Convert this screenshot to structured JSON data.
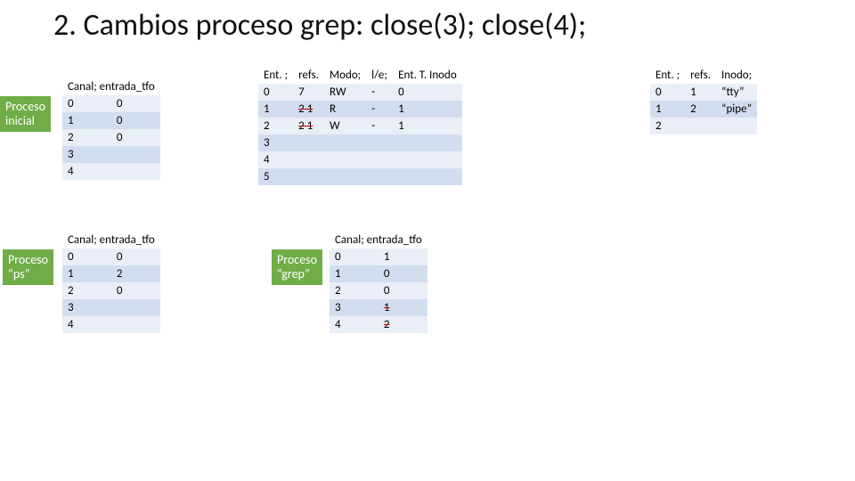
{
  "title": "2. Cambios proceso grep: close(3); close(4);",
  "labels": {
    "inicial": "Proceso\ninicial",
    "ps": "Proceso\n“ps”",
    "grep": "Proceso\n“grep”"
  },
  "headers": {
    "canal_2col": [
      "Canal;",
      "entrada_tfo"
    ],
    "tfo": [
      "Ent. ;",
      "refs.",
      "Modo;",
      "l/e;",
      "Ent. T. Inodo"
    ],
    "inode": [
      "Ent. ;",
      "refs.",
      "Inodo;"
    ]
  },
  "inicial": {
    "rows": [
      {
        "c0": "0",
        "c1": "0"
      },
      {
        "c0": "1",
        "c1": "0"
      },
      {
        "c0": "2",
        "c1": "0"
      },
      {
        "c0": "3",
        "c1": ""
      },
      {
        "c0": "4",
        "c1": ""
      }
    ]
  },
  "ps": {
    "rows": [
      {
        "c0": "0",
        "c1": "0"
      },
      {
        "c0": "1",
        "c1": "2"
      },
      {
        "c0": "2",
        "c1": "0"
      },
      {
        "c0": "3",
        "c1": ""
      },
      {
        "c0": "4",
        "c1": ""
      }
    ]
  },
  "grep": {
    "rows": [
      {
        "c0": "0",
        "c1": "1"
      },
      {
        "c0": "1",
        "c1": "0"
      },
      {
        "c0": "2",
        "c1": "0"
      },
      {
        "c0": "3",
        "c1": "1",
        "strike1": true
      },
      {
        "c0": "4",
        "c1": "2",
        "strike1": true
      }
    ]
  },
  "tfo": {
    "rows": [
      {
        "c0": "0",
        "c1": "7",
        "c1strike": false,
        "c2": "RW",
        "c3": "-",
        "c4": "0"
      },
      {
        "c0": "1",
        "c1": "2 1",
        "c1strike": true,
        "c2": "R",
        "c3": "-",
        "c4": "1"
      },
      {
        "c0": "2",
        "c1": "2 1",
        "c1strike": true,
        "c2": "W",
        "c3": "-",
        "c4": "1"
      },
      {
        "c0": "3",
        "c1": "",
        "c2": "",
        "c3": "",
        "c4": ""
      },
      {
        "c0": "4",
        "c1": "",
        "c2": "",
        "c3": "",
        "c4": ""
      },
      {
        "c0": "5",
        "c1": "",
        "c2": "",
        "c3": "",
        "c4": ""
      }
    ]
  },
  "inode": {
    "rows": [
      {
        "c0": "0",
        "c1": "1",
        "c2": "“tty”"
      },
      {
        "c0": "1",
        "c1": "2",
        "c2": "“pipe”"
      },
      {
        "c0": "2",
        "c1": "",
        "c2": ""
      }
    ]
  }
}
